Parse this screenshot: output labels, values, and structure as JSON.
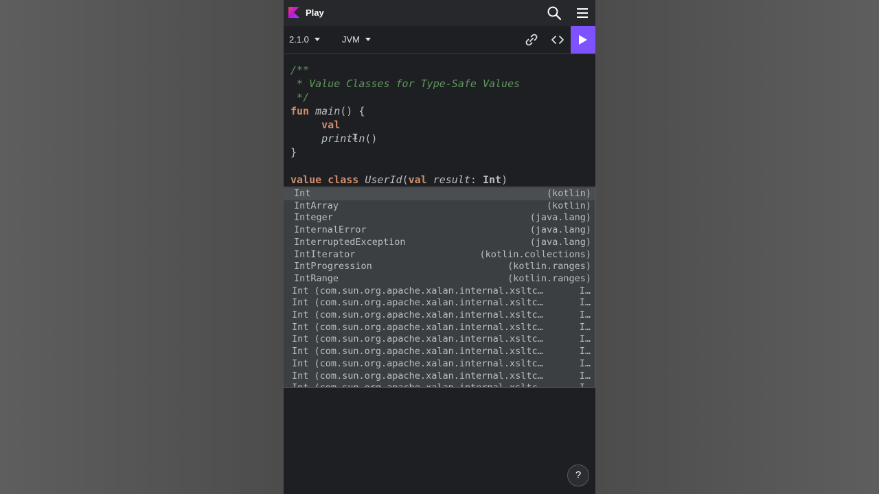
{
  "app": {
    "title": "Play"
  },
  "toolbar": {
    "version": "2.1.0",
    "platform": "JVM"
  },
  "editor": {
    "comment_open": "/**",
    "comment_text": " * Value Classes for Type-Safe Values",
    "comment_close": " */",
    "kw_fun": "fun",
    "main_fn": "main",
    "main_rest": "() {",
    "indent": "     ",
    "kw_val": "val",
    "println_fn": "println",
    "println_rest": "()",
    "close_brace": "}",
    "kw_value": "value",
    "kw_class": "class",
    "class_name": "UserId",
    "open_paren": "(",
    "kw_val2": "val",
    "param": "result",
    "colon": ": ",
    "param_type": "Int",
    "close_paren": ")"
  },
  "completion": {
    "items": [
      {
        "name": "Int",
        "pkg": "(kotlin)"
      },
      {
        "name": "IntArray",
        "pkg": "(kotlin)"
      },
      {
        "name": "Integer",
        "pkg": "(java.lang)"
      },
      {
        "name": "InternalError",
        "pkg": "(java.lang)"
      },
      {
        "name": "InterruptedException",
        "pkg": "(java.lang)"
      },
      {
        "name": "IntIterator",
        "pkg": "(kotlin.collections)"
      },
      {
        "name": "IntProgression",
        "pkg": "(kotlin.ranges)"
      },
      {
        "name": "IntRange",
        "pkg": "(kotlin.ranges)"
      },
      {
        "name": "Int (com.sun.org.apache.xalan.internal.xsltc…",
        "pkg": "I…"
      },
      {
        "name": "Int (com.sun.org.apache.xalan.internal.xsltc…",
        "pkg": "I…"
      },
      {
        "name": "Int (com.sun.org.apache.xalan.internal.xsltc…",
        "pkg": "I…"
      },
      {
        "name": "Int (com.sun.org.apache.xalan.internal.xsltc…",
        "pkg": "I…"
      },
      {
        "name": "Int (com.sun.org.apache.xalan.internal.xsltc…",
        "pkg": "I…"
      },
      {
        "name": "Int (com.sun.org.apache.xalan.internal.xsltc…",
        "pkg": "I…"
      },
      {
        "name": "Int (com.sun.org.apache.xalan.internal.xsltc…",
        "pkg": "I…"
      },
      {
        "name": "Int (com.sun.org.apache.xalan.internal.xsltc…",
        "pkg": "I…"
      },
      {
        "name": "Int (com.sun.org.apache.xalan.internal.xsltc…",
        "pkg": "I…"
      }
    ]
  },
  "help": {
    "label": "?"
  },
  "icons": {
    "logo": "kotlin-logo-icon",
    "search": "search-icon",
    "menu": "hamburger-menu-icon",
    "link": "link-icon",
    "code": "code-brackets-icon",
    "run": "play-icon"
  },
  "colors": {
    "accent": "#7f52ff",
    "keyword": "#cf8e6d",
    "comment": "#5f9a5c"
  }
}
